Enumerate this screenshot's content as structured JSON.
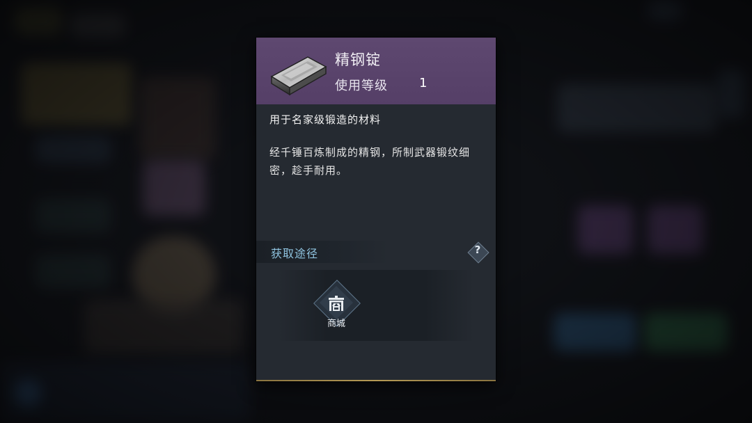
{
  "background": {
    "description_colors": {
      "panel_purple": "#5e4870",
      "panel_body": "#252a31",
      "source_title": "#8fc3df"
    }
  },
  "tooltip": {
    "item_icon": "steel-ingot-icon",
    "item_name": "精钢锭",
    "level_label": "使用等级",
    "level_value": "1",
    "item_type": "用于名家级锻造的材料",
    "description": "经千锤百炼制成的精钢，所制武器锻纹细密，趁手耐用。",
    "source_title": "获取途径",
    "help_icon": "question-icon",
    "help_label": "?",
    "sources": [
      {
        "icon": "shop-icon",
        "label": "商城"
      }
    ]
  }
}
